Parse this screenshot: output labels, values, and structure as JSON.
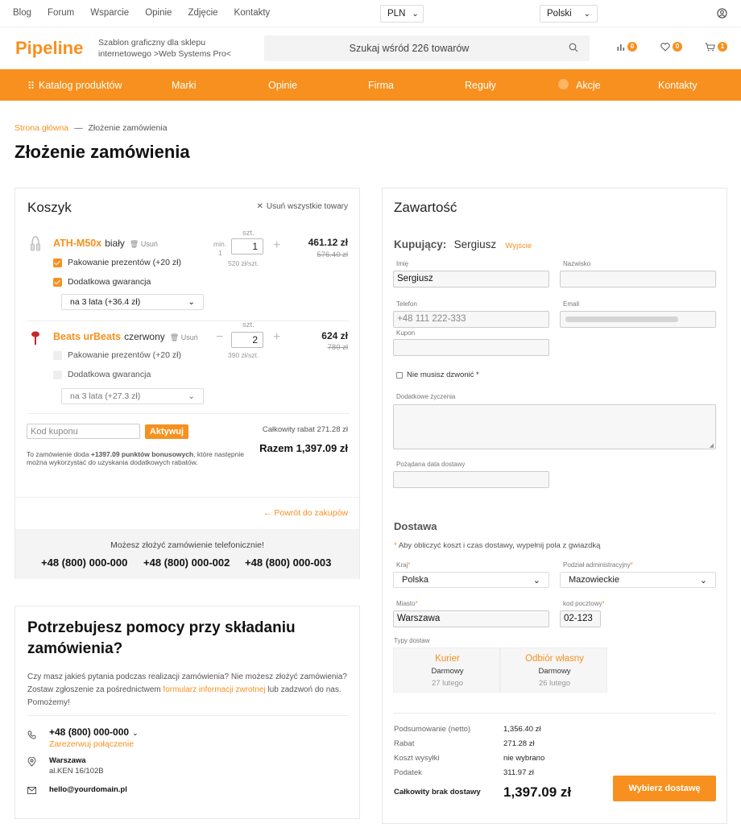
{
  "topbar": {
    "links": [
      "Blog",
      "Forum",
      "Wsparcie",
      "Opinie",
      "Zdjęcie",
      "Kontakty"
    ],
    "currency": "PLN",
    "language": "Polski"
  },
  "header": {
    "logo": "Pipeline",
    "tagline": "Szablon graficzny dla sklepu internetowego >Web Systems Pro<",
    "search_placeholder": "Szukaj wśród 226 towarów",
    "compare_count": "0",
    "wishlist_count": "0",
    "cart_count": "1"
  },
  "nav": {
    "items": [
      "Katalog produktów",
      "Marki",
      "Opinie",
      "Firma",
      "Reguły",
      "Akcje",
      "Kontakty"
    ]
  },
  "breadcrumb": {
    "home": "Strona główna",
    "sep": "—",
    "current": "Złożenie zamówienia"
  },
  "page_title": "Złożenie zamówienia",
  "cart": {
    "title": "Koszyk",
    "remove_all": "Usuń wszystkie towary",
    "qty_unit": "szt.",
    "delete_label": "Usuń",
    "min_label": "min.",
    "min_value": "1",
    "items": [
      {
        "name": "ATH-M50x",
        "color": "biały",
        "qty": "1",
        "unit_price": "520 zł/szt.",
        "price": "461.12 zł",
        "old_price": "576.40 zł",
        "opt1": "Pakowanie prezentów (+20 zł)",
        "opt2": "Dodatkowa gwarancja",
        "warranty": "na 3 lata (+36.4 zł)"
      },
      {
        "name": "Beats urBeats",
        "color": "czerwony",
        "qty": "2",
        "unit_price": "390 zł/szt.",
        "price": "624 zł",
        "old_price": "780 zł",
        "opt1": "Pakowanie prezentów (+20 zł)",
        "opt2": "Dodatkowa gwarancja",
        "warranty": "na 3 lata (+27.3 zł)"
      }
    ],
    "coupon_placeholder": "Kod kuponu",
    "coupon_button": "Aktywuj",
    "discount_total": "Całkowity rabat 271.28 zł",
    "total": "Razem 1,397.09 zł",
    "bonus_prefix": "To zamówienie doda ",
    "bonus_points": "+1397.09 punktów bonusowych",
    "bonus_suffix": ", które następnie można wykorzystać do uzyskania dodatkowych rabatów.",
    "back_link": "← Powrót do zakupów",
    "phone_note": "Możesz złożyć zamówienie telefonicznie!",
    "phones": [
      "+48 (800) 000-000",
      "+48 (800) 000-002",
      "+48 (800) 000-003"
    ]
  },
  "help": {
    "title": "Potrzebujesz pomocy przy składaniu zamówienia?",
    "text_before": "Czy masz jakieś pytania podczas realizacji zamówienia? Nie możesz złożyć zamówienia? Zostaw zgłoszenie za pośrednictwem ",
    "text_link": "formularz informacji zwrotnej",
    "text_after": " lub zadzwoń do nas. Pomożemy!",
    "phone": "+48 (800) 000-000",
    "call_link": "Zarezerwuj połączenie",
    "city": "Warszawa",
    "address": "al.KEN 16/102B",
    "email": "hello@yourdomain.pl"
  },
  "content": {
    "title": "Zawartość",
    "buyer_label": "Kupujący:",
    "buyer_name": "Sergiusz",
    "logout": "Wyjście",
    "first_name_label": "Imię",
    "first_name": "Sergiusz",
    "last_name_label": "Nazwisko",
    "last_name": "",
    "phone_label": "Telefon",
    "phone_value": "+48 111 222-333",
    "email_label": "Email",
    "coupon_label": "Kupon",
    "no_call_label": "Nie musisz dzwonić *",
    "wishes_label": "Dodatkowe życzenia",
    "date_label": "Pożądana data dostawy"
  },
  "delivery": {
    "title": "Dostawa",
    "note": "Aby obliczyć koszt i czas dostawy, wypełnij pola z gwiazdką",
    "country_label": "Kraj",
    "country": "Polska",
    "region_label": "Podział administracyjny",
    "region": "Mazowieckie",
    "city_label": "Miasto",
    "city": "Warszawa",
    "zip_label": "kod pocztowy",
    "zip": "02-123",
    "types_label": "Typy dostaw",
    "options": [
      {
        "name": "Kurier",
        "price": "Darmowy",
        "date": "27 lutego"
      },
      {
        "name": "Odbiór własny",
        "price": "Darmowy",
        "date": "26 lutego"
      }
    ]
  },
  "summary": {
    "rows": [
      {
        "label": "Podsumowanie (netto)",
        "value": "1,356.40 zł"
      },
      {
        "label": "Rabat",
        "value": "271.28 zł"
      },
      {
        "label": "Koszt wysyłki",
        "value": "nie wybrano"
      },
      {
        "label": "Podatek",
        "value": "311.97 zł"
      }
    ],
    "total_label": "Całkowity brak dostawy",
    "total_value": "1,397.09 zł",
    "button": "Wybierz dostawę"
  },
  "colors": {
    "accent": "#f7901e"
  }
}
